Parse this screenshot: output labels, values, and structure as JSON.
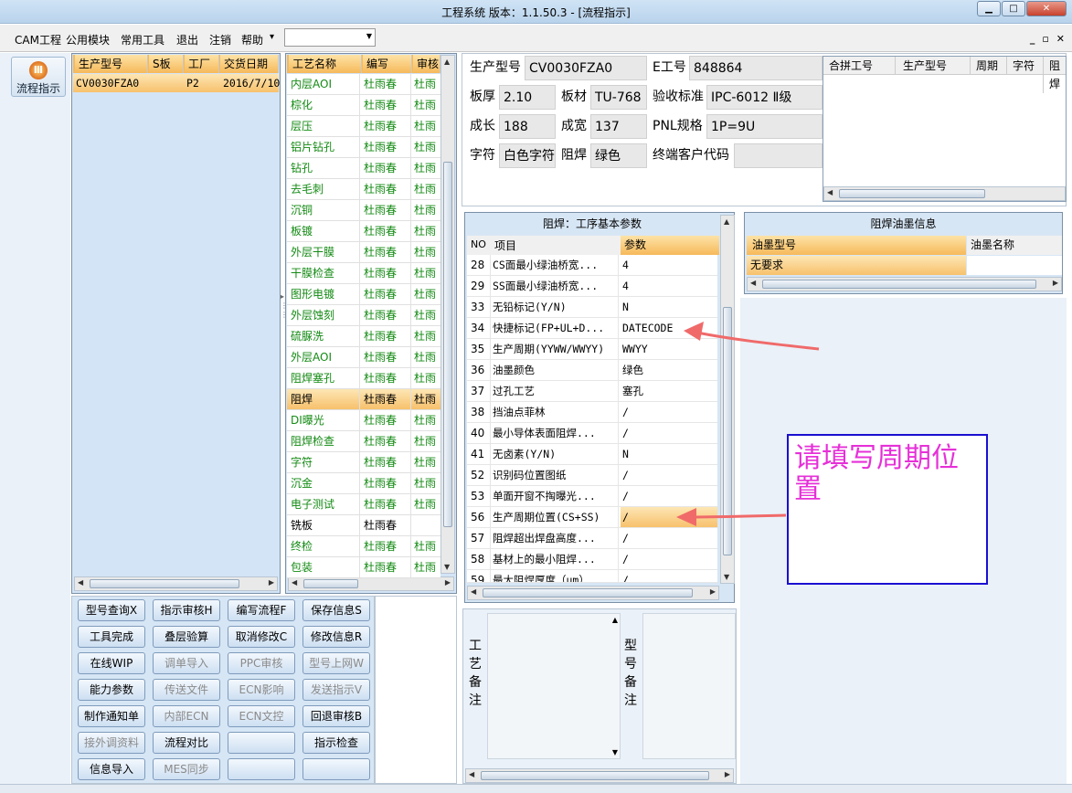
{
  "window": {
    "title": "工程系统   版本：1.1.50.3 - [流程指示]"
  },
  "menu": {
    "items": [
      "CAM工程",
      "公用模块",
      "常用工具",
      "退出",
      "注销",
      "帮助"
    ],
    "help_arrow": "▾"
  },
  "nav": {
    "flow_button": "流程指示"
  },
  "model_list": {
    "headers": [
      "生产型号",
      "S板",
      "工厂",
      "交货日期"
    ],
    "rows": [
      {
        "model": "CV0030FZA0",
        "s": "",
        "factory": "P2",
        "date": "2016/7/10"
      }
    ]
  },
  "process_list": {
    "headers": [
      "工艺名称",
      "编写",
      "审核"
    ],
    "rows": [
      {
        "name": "内层AOI",
        "writer": "杜雨春",
        "review": "杜雨"
      },
      {
        "name": "棕化",
        "writer": "杜雨春",
        "review": "杜雨"
      },
      {
        "name": "层压",
        "writer": "杜雨春",
        "review": "杜雨"
      },
      {
        "name": "铝片钻孔",
        "writer": "杜雨春",
        "review": "杜雨"
      },
      {
        "name": "钻孔",
        "writer": "杜雨春",
        "review": "杜雨"
      },
      {
        "name": "去毛刺",
        "writer": "杜雨春",
        "review": "杜雨"
      },
      {
        "name": "沉铜",
        "writer": "杜雨春",
        "review": "杜雨"
      },
      {
        "name": "板镀",
        "writer": "杜雨春",
        "review": "杜雨"
      },
      {
        "name": "外层干膜",
        "writer": "杜雨春",
        "review": "杜雨"
      },
      {
        "name": "干膜检查",
        "writer": "杜雨春",
        "review": "杜雨"
      },
      {
        "name": "图形电镀",
        "writer": "杜雨春",
        "review": "杜雨"
      },
      {
        "name": "外层蚀刻",
        "writer": "杜雨春",
        "review": "杜雨"
      },
      {
        "name": "硫脲洗",
        "writer": "杜雨春",
        "review": "杜雨"
      },
      {
        "name": "外层AOI",
        "writer": "杜雨春",
        "review": "杜雨"
      },
      {
        "name": "阻焊塞孔",
        "writer": "杜雨春",
        "review": "杜雨"
      },
      {
        "name": "阻焊",
        "writer": "杜雨春",
        "review": "杜雨"
      },
      {
        "name": "DI曝光",
        "writer": "杜雨春",
        "review": "杜雨"
      },
      {
        "name": "阻焊检查",
        "writer": "杜雨春",
        "review": "杜雨"
      },
      {
        "name": "字符",
        "writer": "杜雨春",
        "review": "杜雨"
      },
      {
        "name": "沉金",
        "writer": "杜雨春",
        "review": "杜雨"
      },
      {
        "name": "电子测试",
        "writer": "杜雨春",
        "review": "杜雨"
      },
      {
        "name": "铣板",
        "writer": "杜雨春",
        "review": ""
      },
      {
        "name": "终检",
        "writer": "杜雨春",
        "review": "杜雨"
      },
      {
        "name": "包装",
        "writer": "杜雨春",
        "review": "杜雨"
      }
    ]
  },
  "info": {
    "model_label": "生产型号",
    "model": "CV0030FZA0",
    "eno_label": "E工号",
    "eno": "848864",
    "thick_label": "板厚",
    "thick": "2.10",
    "mat_label": "板材",
    "mat": "TU-768",
    "std_label": "验收标准",
    "std": "IPC-6012 Ⅱ级",
    "len_label": "成长",
    "len": "188",
    "wid_label": "成宽",
    "wid": "137",
    "pnl_label": "PNL规格",
    "pnl": "1P=9U",
    "char_label": "字符",
    "char": "白色字符",
    "mask_label": "阻焊",
    "mask": "绿色",
    "cust_label": "终端客户代码",
    "cust": ""
  },
  "merge_table": {
    "headers": [
      "合拼工号",
      "生产型号",
      "周期",
      "字符",
      "阻焊"
    ]
  },
  "params": {
    "title": "阻焊：工序基本参数",
    "headers": [
      "NO",
      "项目",
      "参数"
    ],
    "rows": [
      {
        "no": "28",
        "item": "CS面最小绿油桥宽...",
        "val": "4"
      },
      {
        "no": "29",
        "item": "SS面最小绿油桥宽...",
        "val": "4"
      },
      {
        "no": "33",
        "item": "无铅标记(Y/N)",
        "val": "N"
      },
      {
        "no": "34",
        "item": "快捷标记(FP+UL+D...",
        "val": "DATECODE"
      },
      {
        "no": "35",
        "item": "生产周期(YYWW/WWYY)",
        "val": "WWYY"
      },
      {
        "no": "36",
        "item": "油墨颜色",
        "val": "绿色"
      },
      {
        "no": "37",
        "item": "过孔工艺",
        "val": "塞孔"
      },
      {
        "no": "38",
        "item": "挡油点菲林",
        "val": "/"
      },
      {
        "no": "40",
        "item": "最小导体表面阻焊...",
        "val": "/"
      },
      {
        "no": "41",
        "item": "无卤素(Y/N)",
        "val": "N"
      },
      {
        "no": "52",
        "item": "识别码位置图纸",
        "val": "/"
      },
      {
        "no": "53",
        "item": "单面开窗不掏曝光...",
        "val": "/"
      },
      {
        "no": "56",
        "item": "生产周期位置(CS+SS)",
        "val": "/"
      },
      {
        "no": "57",
        "item": "阻焊超出焊盘高度...",
        "val": "/"
      },
      {
        "no": "58",
        "item": "基材上的最小阻焊...",
        "val": "/"
      },
      {
        "no": "59",
        "item": "最大阻焊厚度（μm）",
        "val": "/"
      }
    ]
  },
  "ink": {
    "title": "阻焊油墨信息",
    "headers": [
      "油墨型号",
      "油墨名称"
    ],
    "rows": [
      {
        "type": "无要求",
        "name": ""
      }
    ]
  },
  "notes": {
    "process_label": "工艺备注",
    "model_label": "型号备注"
  },
  "buttons": [
    {
      "label": "型号查询X",
      "enabled": true
    },
    {
      "label": "指示审核H",
      "enabled": true
    },
    {
      "label": "编写流程F",
      "enabled": true
    },
    {
      "label": "保存信息S",
      "enabled": true
    },
    {
      "label": "工具完成",
      "enabled": true
    },
    {
      "label": "叠层验算",
      "enabled": true
    },
    {
      "label": "取消修改C",
      "enabled": true
    },
    {
      "label": "修改信息R",
      "enabled": true
    },
    {
      "label": "在线WIP",
      "enabled": true
    },
    {
      "label": "调单导入",
      "enabled": false
    },
    {
      "label": "PPC审核",
      "enabled": false
    },
    {
      "label": "型号上网W",
      "enabled": false
    },
    {
      "label": "能力参数",
      "enabled": true
    },
    {
      "label": "传送文件",
      "enabled": false
    },
    {
      "label": "ECN影响",
      "enabled": false
    },
    {
      "label": "发送指示V",
      "enabled": false
    },
    {
      "label": "制作通知单",
      "enabled": true
    },
    {
      "label": "内部ECN",
      "enabled": false
    },
    {
      "label": "ECN文控",
      "enabled": false
    },
    {
      "label": "回退审核B",
      "enabled": true
    },
    {
      "label": "接外调资料",
      "enabled": false
    },
    {
      "label": "流程对比",
      "enabled": true
    },
    {
      "label": "",
      "enabled": true
    },
    {
      "label": "指示检查",
      "enabled": true
    },
    {
      "label": "信息导入",
      "enabled": true
    },
    {
      "label": "MES同步",
      "enabled": false
    },
    {
      "label": "",
      "enabled": true
    },
    {
      "label": "",
      "enabled": true
    }
  ],
  "annotation": {
    "text": "请填写周期位置"
  }
}
